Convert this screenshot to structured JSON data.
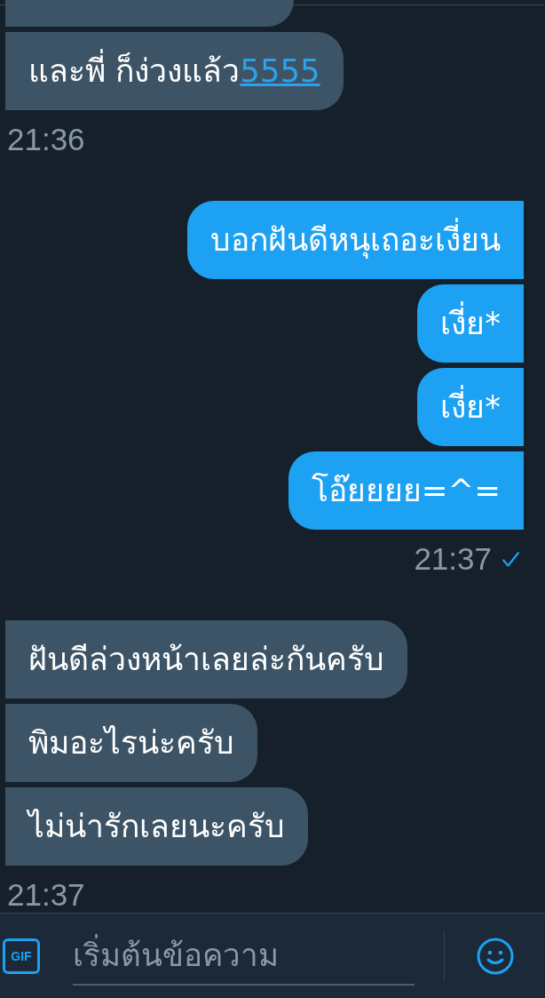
{
  "conversation": {
    "groups": [
      {
        "kind": "received",
        "messages": [
          {
            "kind": "partial"
          },
          {
            "kind": "text",
            "text": "และพี่ ก็ง่วงแล้ว",
            "link": "5555"
          }
        ],
        "time": "21:36",
        "check": false
      },
      {
        "kind": "sent",
        "messages": [
          {
            "kind": "text",
            "text": "บอกฝันดีหนุเถอะเงี่ยน"
          },
          {
            "kind": "text",
            "text": "เงี่ย*"
          },
          {
            "kind": "text",
            "text": "เงี่ย*"
          },
          {
            "kind": "text",
            "text": "โอ๊ยยยย=^="
          }
        ],
        "time": "21:37",
        "check": true
      },
      {
        "kind": "received",
        "messages": [
          {
            "kind": "text",
            "text": "ฝันดีล่วงหน้าเลยล่ะกันครับ"
          },
          {
            "kind": "text",
            "text": "พิมอะไรน่ะครับ"
          },
          {
            "kind": "text",
            "text": "ไม่น่ารักเลยนะครับ"
          }
        ],
        "time": "21:37",
        "check": false
      }
    ]
  },
  "composer": {
    "gif_button": "GIF",
    "placeholder": "เริ่มต้นข้อความ"
  }
}
